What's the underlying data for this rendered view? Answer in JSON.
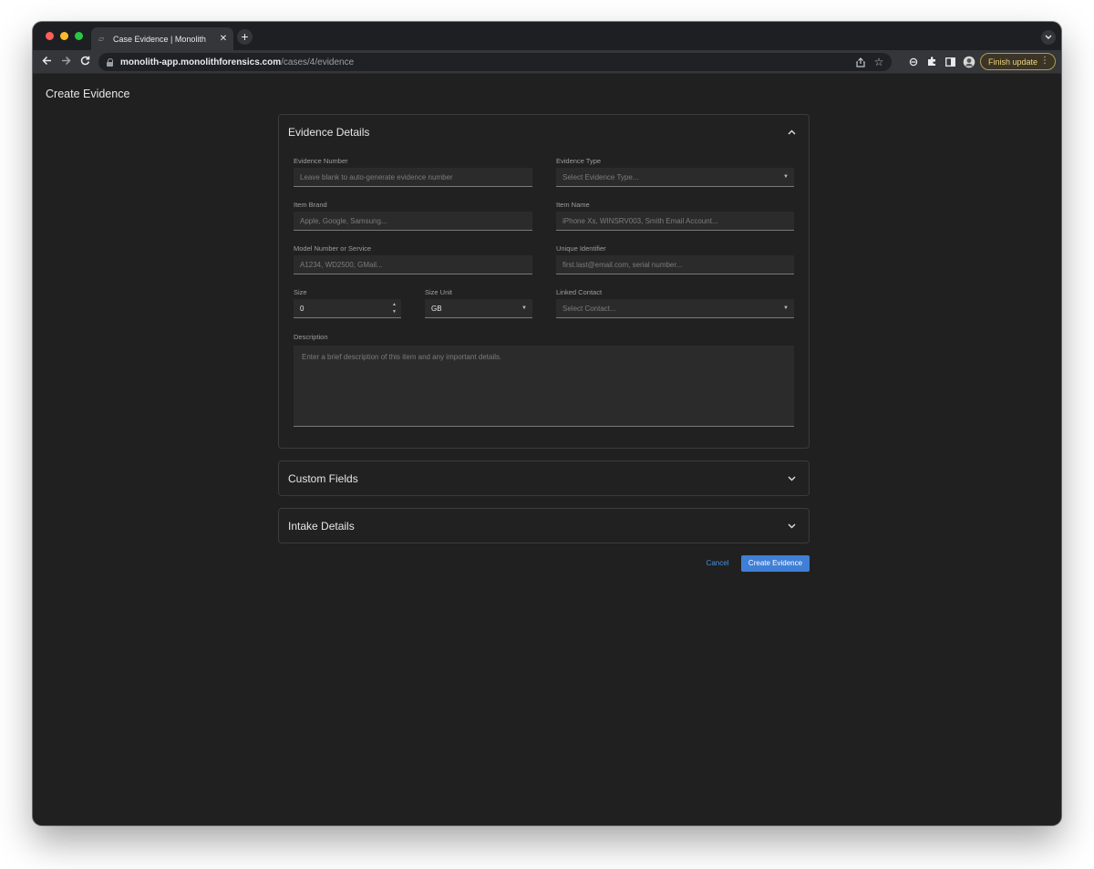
{
  "browser": {
    "tab_title": "Case Evidence | Monolith",
    "tab_close": "✕",
    "new_tab": "+",
    "url_host": "monolith-app.monolithforensics.com",
    "url_path": "/cases/4/evidence",
    "finish_update": "Finish update",
    "traffic_lights": [
      "#ff5f57",
      "#febc2e",
      "#28c840"
    ]
  },
  "page": {
    "title": "Create Evidence"
  },
  "evidence_details": {
    "title": "Evidence Details",
    "fields": {
      "evidence_number": {
        "label": "Evidence Number",
        "placeholder": "Leave blank to auto-generate evidence number"
      },
      "evidence_type": {
        "label": "Evidence Type",
        "placeholder": "Select Evidence Type..."
      },
      "item_brand": {
        "label": "Item Brand",
        "placeholder": "Apple, Google, Samsung..."
      },
      "item_name": {
        "label": "Item Name",
        "placeholder": "iPhone Xs, WINSRV003, Smith Email Account..."
      },
      "model_number": {
        "label": "Model Number or Service",
        "placeholder": "A1234, WD2500, GMail..."
      },
      "unique_identifier": {
        "label": "Unique Identifier",
        "placeholder": "first.last@email.com, serial number..."
      },
      "size": {
        "label": "Size",
        "value": "0"
      },
      "size_unit": {
        "label": "Size Unit",
        "value": "GB"
      },
      "linked_contact": {
        "label": "Linked Contact",
        "placeholder": "Select Contact..."
      },
      "description": {
        "label": "Description",
        "placeholder": "Enter a brief description of this item and any important details."
      }
    }
  },
  "custom_fields": {
    "title": "Custom Fields"
  },
  "intake_details": {
    "title": "Intake Details"
  },
  "actions": {
    "cancel": "Cancel",
    "create": "Create Evidence"
  },
  "colors": {
    "accent": "#3f7fd6",
    "link": "#4a90d9",
    "update_badge": "#f0d37c"
  },
  "icons": {
    "back": "arrow-left-icon",
    "forward": "arrow-right-icon",
    "reload": "reload-icon",
    "lock": "lock-icon",
    "share": "share-icon",
    "bookmark": "star-icon",
    "extensions": "puzzle-icon",
    "sidepanel": "side-panel-icon",
    "expand": "chevron-up-icon",
    "collapse": "chevron-down-icon"
  }
}
